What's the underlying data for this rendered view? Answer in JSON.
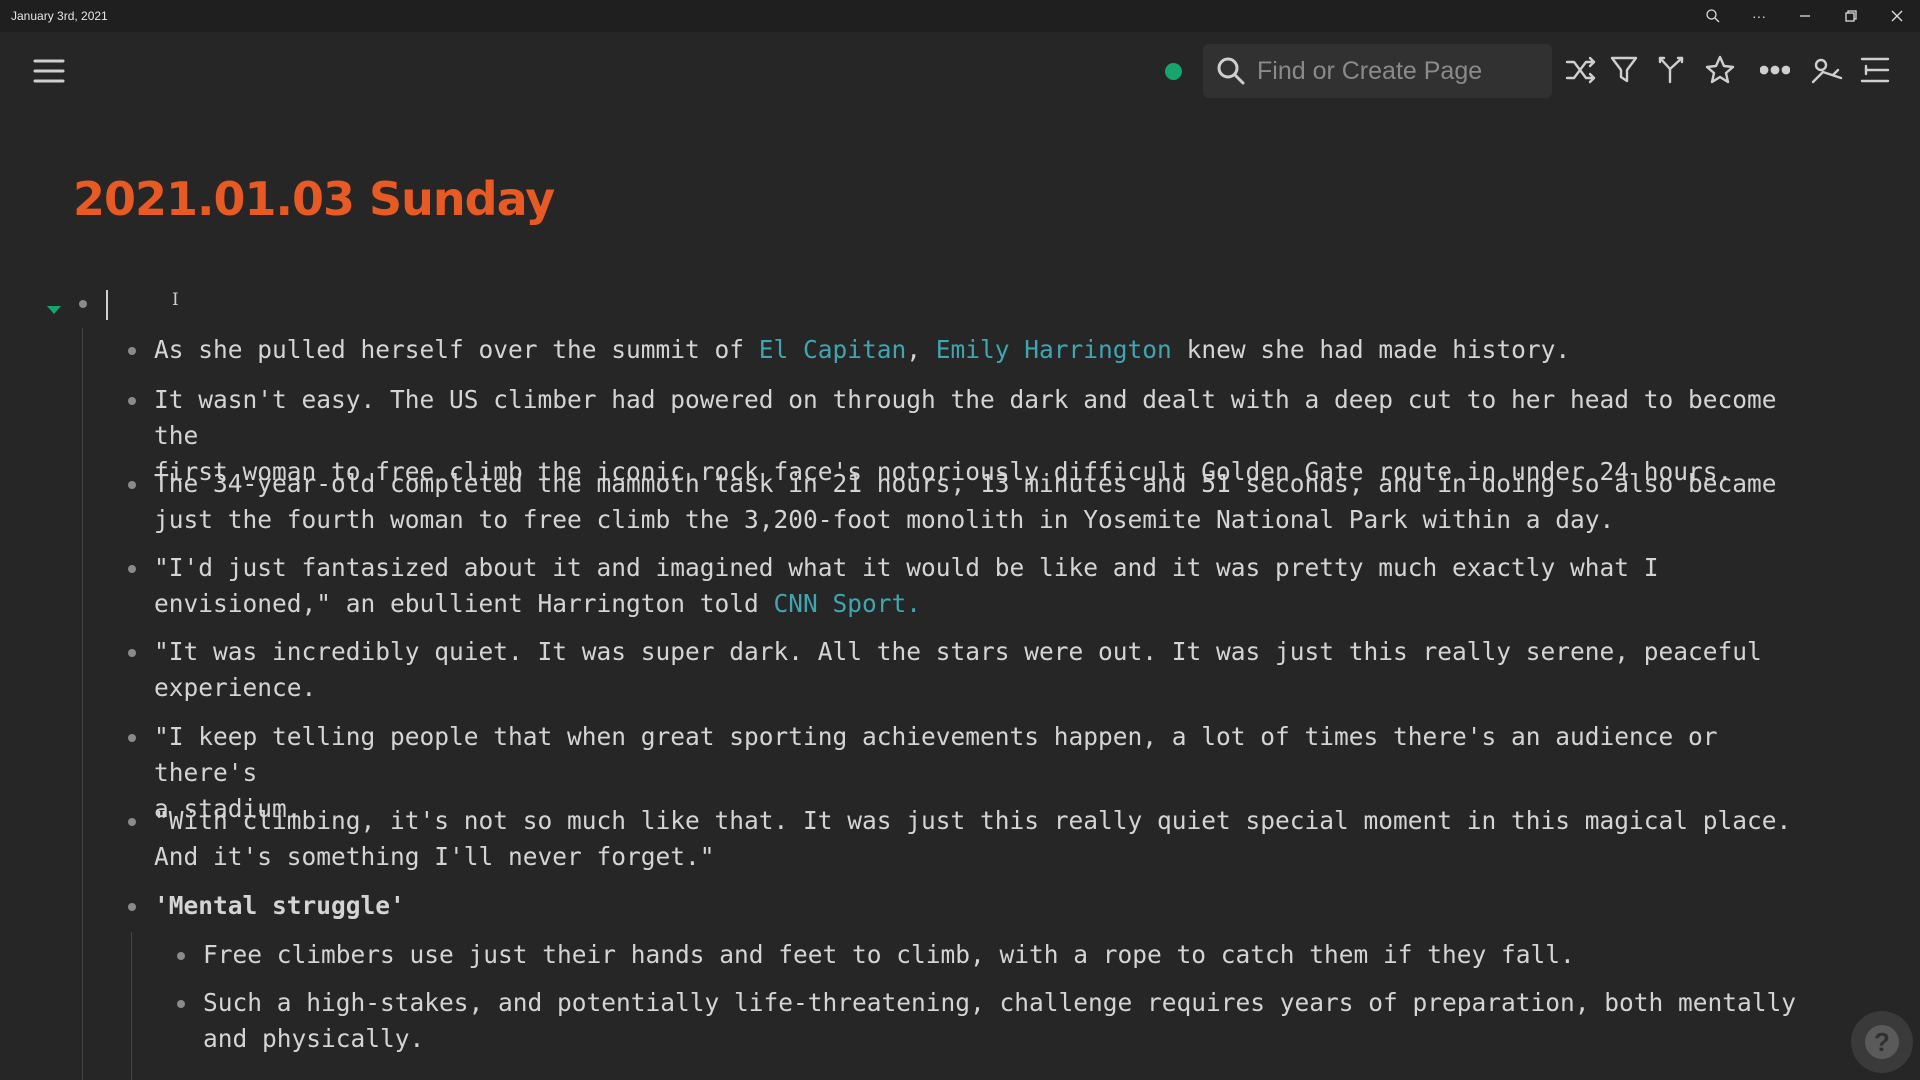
{
  "window": {
    "title": "January 3rd, 2021"
  },
  "toolbar": {
    "search_placeholder": "Find or Create Page",
    "sync_color": "#16a56b",
    "icons": [
      "menu-icon",
      "search-icon",
      "shuffle-icon",
      "filter-icon",
      "branch-icon",
      "star-icon",
      "more-icon",
      "sidebar-graph-icon",
      "right-sidebar-icon"
    ]
  },
  "page": {
    "title": "2021.01.03 Sunday",
    "title_color": "#e85a23"
  },
  "blocks": [
    {
      "segments": [
        {
          "text": "As she pulled herself over the summit of "
        },
        {
          "text": "El Capitan",
          "link": true
        },
        {
          "text": ", "
        },
        {
          "text": "Emily Harrington",
          "link": true
        },
        {
          "text": " knew she had made history."
        }
      ]
    },
    {
      "lines": [
        "It wasn't easy. The US climber had powered on through the dark and dealt with a deep cut to her head to become the",
        "first woman to free climb the iconic rock face's notoriously difficult Golden Gate route in under 24 hours."
      ]
    },
    {
      "lines": [
        "The 34-year-old completed the mammoth task in 21 hours, 13 minutes and 51 seconds, and in doing so also became",
        "just the fourth woman to free climb the 3,200-foot monolith in Yosemite National Park within a day."
      ]
    },
    {
      "line1": "\"I'd just fantasized about it and imagined what it would be like and it was pretty much exactly what I",
      "line2_prefix": "envisioned,\" an ebullient Harrington told ",
      "line2_link": "CNN Sport."
    },
    {
      "lines": [
        "\"It was incredibly quiet. It was super dark. All the stars were out. It was just this really serene, peaceful",
        "experience."
      ]
    },
    {
      "lines": [
        "\"I keep telling people that when great sporting achievements happen, a lot of times there's an audience or there's",
        "a stadium."
      ]
    },
    {
      "lines": [
        "\"With climbing, it's not so much like that. It was just this really quiet special moment in this magical place.",
        "And it's something I'll never forget.\""
      ]
    },
    {
      "heading": "'Mental struggle'",
      "heading_color": "#f0a030",
      "children": [
        {
          "lines": [
            "Free climbers use just their hands and feet to climb, with a rope to catch them if they fall."
          ]
        },
        {
          "lines": [
            "Such a high-stakes, and potentially life-threatening, challenge requires years of preparation, both mentally",
            "and physically."
          ]
        }
      ]
    }
  ]
}
